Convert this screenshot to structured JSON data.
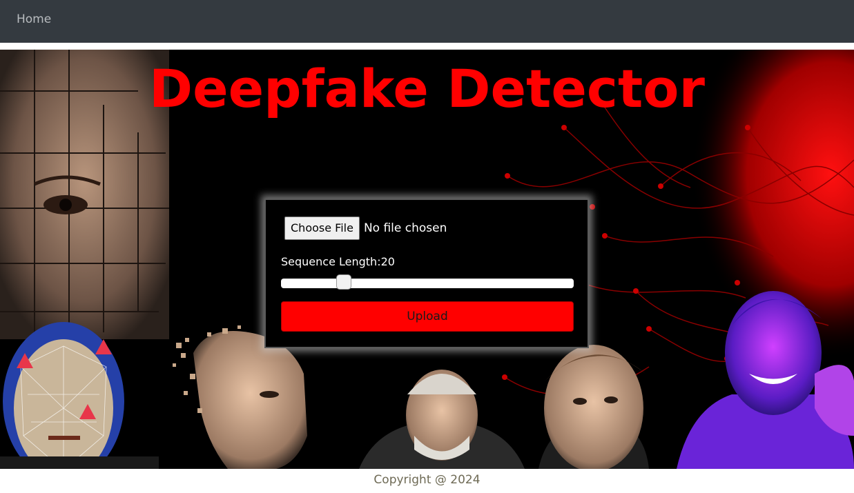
{
  "nav": {
    "home_label": "Home"
  },
  "hero": {
    "title": "Deepfake Detector"
  },
  "upload_form": {
    "choose_file_label": "Choose File",
    "file_status": "No file chosen",
    "sequence_label": "Sequence Length:20",
    "sequence_value": 20,
    "sequence_fraction": 0.2,
    "upload_label": "Upload"
  },
  "footer": {
    "copyright": "Copyright @ 2024"
  },
  "colors": {
    "navbar_bg": "#343a40",
    "accent_red": "#ff0000",
    "hero_bg": "#000000"
  }
}
